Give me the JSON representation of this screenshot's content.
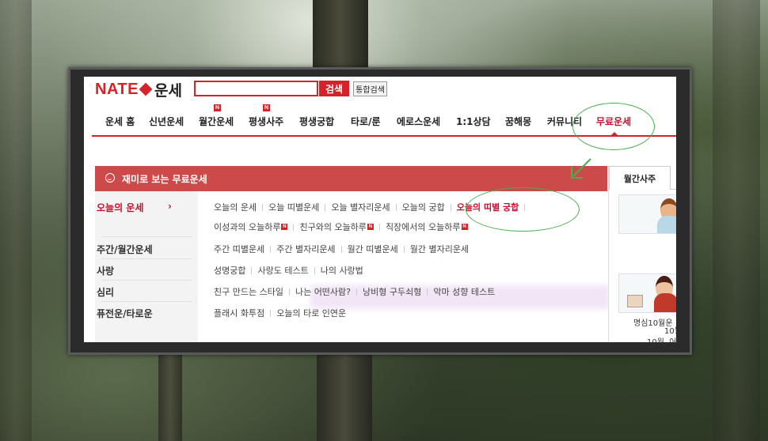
{
  "header": {
    "logo_brand": "NATE",
    "logo_title": "운세",
    "search_placeholder": "",
    "search_button": "검색",
    "total_search_button": "통합검색"
  },
  "nav": {
    "new_badge": "N",
    "items": [
      {
        "label": "운세 홈"
      },
      {
        "label": "신년운세"
      },
      {
        "label": "월간운세",
        "new": true
      },
      {
        "label": "평생사주",
        "new": true
      },
      {
        "label": "평생궁합"
      },
      {
        "label": "타로/룬"
      },
      {
        "label": "에로스운세"
      },
      {
        "label": "1:1상담"
      },
      {
        "label": "꿈해몽"
      },
      {
        "label": "커뮤니티"
      },
      {
        "label": "무료운세",
        "active": true
      }
    ]
  },
  "section": {
    "title": "재미로 보는 무료운세"
  },
  "categories": [
    {
      "label": "오늘의 운세",
      "active": true,
      "arrow": "›"
    },
    {
      "label": "주간/월간운세"
    },
    {
      "label": "사랑"
    },
    {
      "label": "심리"
    },
    {
      "label": "퓨전운/타로운"
    }
  ],
  "links": {
    "row1": [
      "오늘의 운세",
      "오늘 띠별운세",
      "오늘 별자리운세",
      "오늘의 궁합",
      "오늘의 띠별 궁합"
    ],
    "row2": [
      "이성과의 오늘하루",
      "친구와의 오늘하루",
      "직장에서의 오늘하루"
    ],
    "row3": [
      "주간 띠별운세",
      "주간 별자리운세",
      "월간 띠별운세",
      "월간 별자리운세"
    ],
    "row4": [
      "성명궁합",
      "사랑도 테스트",
      "나의 사랑법"
    ],
    "row5": [
      "친구 만드는 스타일",
      "나는 어떤사람?",
      "낭비형 구두쇠형",
      "악마 성향 테스트"
    ],
    "row6": [
      "플래시 화투점",
      "오늘의 타로 인연운"
    ]
  },
  "sidebar": {
    "tab": "월간사주",
    "card1_line1": "10월",
    "card1_line2": "10월, 어",
    "card2_caption": "명심10월운"
  },
  "colors": {
    "brand_red": "#d6232a",
    "section_bar": "#cc4a4a",
    "annotation_green": "#46b04a"
  }
}
